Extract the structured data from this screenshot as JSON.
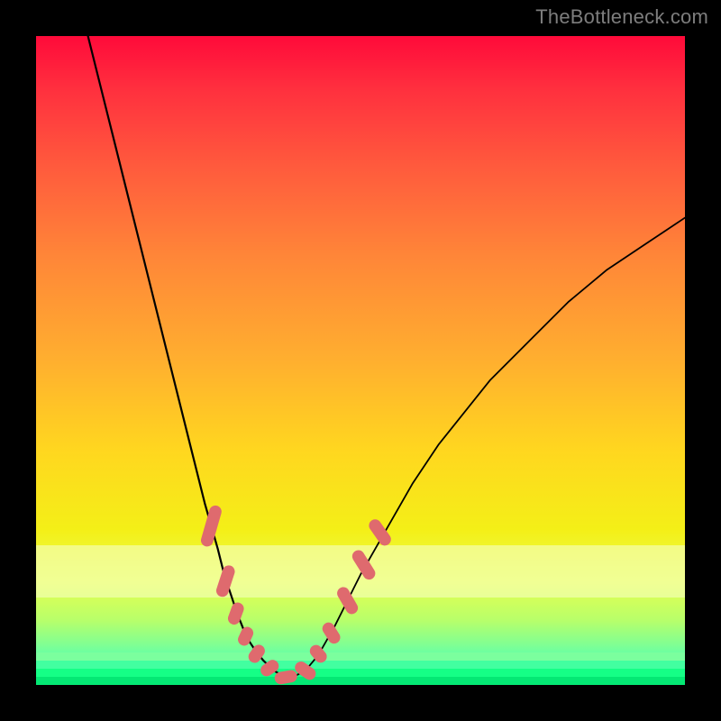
{
  "watermark": "TheBottleneck.com",
  "colors": {
    "frame": "#000000",
    "curve": "#000000",
    "marker": "#df6a6e",
    "watermark": "#7d7d7d"
  },
  "chart_data": {
    "type": "line",
    "title": "",
    "xlabel": "",
    "ylabel": "",
    "xlim": [
      0,
      100
    ],
    "ylim": [
      0,
      100
    ],
    "grid": false,
    "legend": false,
    "series": [
      {
        "name": "left-curve",
        "x": [
          8,
          10,
          12,
          14,
          16,
          18,
          20,
          22,
          24,
          26,
          28,
          29,
          30,
          31,
          32,
          33,
          34,
          35,
          36,
          37,
          38,
          39
        ],
        "y": [
          100,
          92,
          84,
          76,
          68,
          60,
          52,
          44,
          36,
          28,
          21,
          17,
          14,
          11,
          8.5,
          6.5,
          5,
          3.8,
          2.8,
          2,
          1.4,
          1
        ]
      },
      {
        "name": "right-curve",
        "x": [
          39,
          40,
          41,
          42,
          43,
          44,
          46,
          48,
          50,
          54,
          58,
          62,
          66,
          70,
          76,
          82,
          88,
          94,
          100
        ],
        "y": [
          1,
          1.4,
          2,
          2.8,
          4,
          5.5,
          9,
          13,
          17,
          24,
          31,
          37,
          42,
          47,
          53,
          59,
          64,
          68,
          72
        ]
      }
    ],
    "markers": [
      {
        "x": 27.0,
        "y": 24.5,
        "len": 6.5,
        "angle": -74
      },
      {
        "x": 29.2,
        "y": 16.0,
        "len": 5.0,
        "angle": -72
      },
      {
        "x": 30.8,
        "y": 11.0,
        "len": 3.5,
        "angle": -70
      },
      {
        "x": 32.3,
        "y": 7.5,
        "len": 3.0,
        "angle": -65
      },
      {
        "x": 34.0,
        "y": 4.8,
        "len": 3.0,
        "angle": -55
      },
      {
        "x": 36.0,
        "y": 2.6,
        "len": 3.0,
        "angle": -35
      },
      {
        "x": 38.5,
        "y": 1.2,
        "len": 3.5,
        "angle": -10
      },
      {
        "x": 41.5,
        "y": 2.2,
        "len": 3.5,
        "angle": 35
      },
      {
        "x": 43.5,
        "y": 4.8,
        "len": 3.0,
        "angle": 50
      },
      {
        "x": 45.5,
        "y": 8.0,
        "len": 3.5,
        "angle": 58
      },
      {
        "x": 48.0,
        "y": 13.0,
        "len": 4.5,
        "angle": 60
      },
      {
        "x": 50.5,
        "y": 18.5,
        "len": 5.0,
        "angle": 58
      },
      {
        "x": 53.0,
        "y": 23.5,
        "len": 4.5,
        "angle": 55
      }
    ]
  }
}
